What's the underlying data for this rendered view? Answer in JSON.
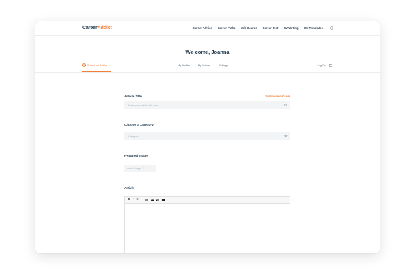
{
  "brand": {
    "logo_part1": "Career",
    "logo_part2": "Addict"
  },
  "nav": {
    "items": [
      "Career Advice",
      "Career Paths",
      "Job Boards",
      "Career Test",
      "CV Writing",
      "CV Templates"
    ]
  },
  "welcome": "Welcome, Joanna",
  "subnav": {
    "submit_label": "Submit an Article",
    "tabs": [
      "My Profile",
      "My Articles",
      "Settings"
    ],
    "logout_label": "Log Out"
  },
  "form": {
    "title_label": "Article Title",
    "guide_link": "Submission Guide",
    "title_placeholder": "Enter your article title here",
    "category_label": "Choose a Category",
    "category_placeholder": "Category",
    "image_label": "Featured Image",
    "image_button": "Insert Image",
    "article_label": "Article",
    "toolbar": {
      "bold": "B",
      "italic": "I",
      "underline": "U"
    }
  },
  "colors": {
    "accent": "#f07f3c",
    "text": "#1f3a4d"
  },
  "icons": [
    "search-icon",
    "pencil-icon",
    "logout-icon",
    "chevron-down-icon",
    "close-icon"
  ]
}
